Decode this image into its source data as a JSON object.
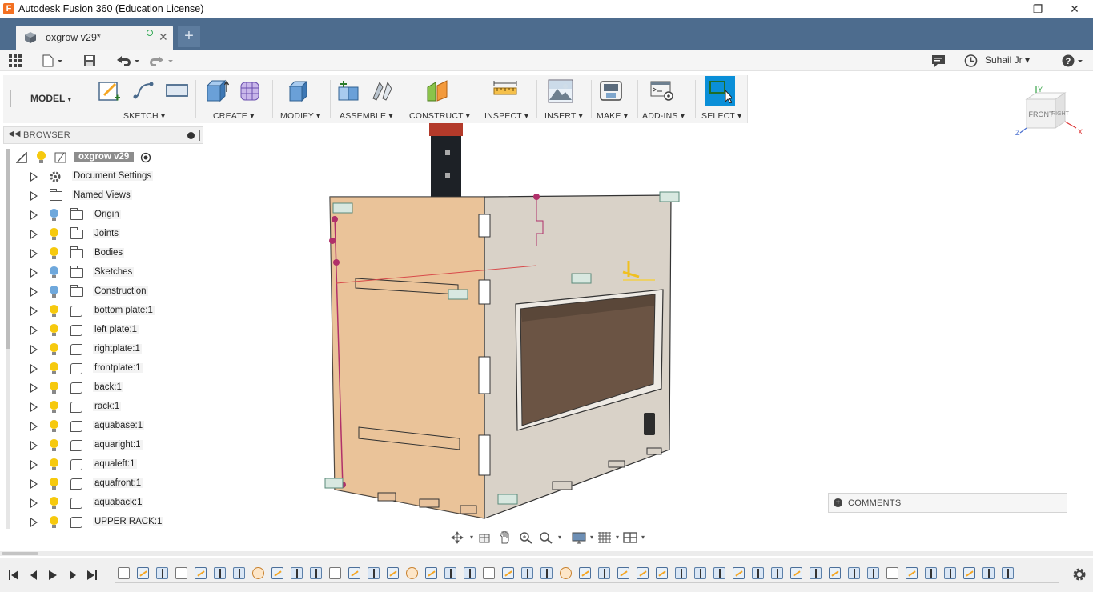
{
  "window": {
    "title": "Autodesk Fusion 360 (Education License)",
    "app_icon": "F",
    "minimize": "—",
    "maximize": "❐",
    "close": "✕"
  },
  "tab": {
    "name": "oxgrow v29*",
    "close": "✕",
    "new": "+"
  },
  "quickbar": {
    "user": "Suhail Jr",
    "user_caret": "▾",
    "help": "?"
  },
  "ribbon": {
    "workspace": "MODEL",
    "groups": [
      {
        "label": "SKETCH"
      },
      {
        "label": "CREATE"
      },
      {
        "label": "MODIFY"
      },
      {
        "label": "ASSEMBLE"
      },
      {
        "label": "CONSTRUCT"
      },
      {
        "label": "INSPECT"
      },
      {
        "label": "INSERT"
      },
      {
        "label": "MAKE"
      },
      {
        "label": "ADD-INS"
      },
      {
        "label": "SELECT"
      }
    ],
    "caret": "▾",
    "accent": "#0a8fd8"
  },
  "browser": {
    "title": "BROWSER",
    "root": "oxgrow v29",
    "items": [
      {
        "label": "Document Settings",
        "icon": "gear-icon"
      },
      {
        "label": "Named Views",
        "icon": "folder-icon"
      },
      {
        "label": "Origin",
        "icon": "folder-icon",
        "bulb": "blue"
      },
      {
        "label": "Joints",
        "icon": "folder-icon",
        "bulb": "yellow"
      },
      {
        "label": "Bodies",
        "icon": "folder-icon",
        "bulb": "yellow"
      },
      {
        "label": "Sketches",
        "icon": "folder-icon",
        "bulb": "blue"
      },
      {
        "label": "Construction",
        "icon": "folder-icon",
        "bulb": "blue"
      },
      {
        "label": "bottom plate:1",
        "icon": "component-icon",
        "bulb": "yellow"
      },
      {
        "label": "left plate:1",
        "icon": "component-icon",
        "bulb": "yellow"
      },
      {
        "label": "rightplate:1",
        "icon": "component-icon",
        "bulb": "yellow"
      },
      {
        "label": "frontplate:1",
        "icon": "component-icon",
        "bulb": "yellow"
      },
      {
        "label": "back:1",
        "icon": "component-icon",
        "bulb": "yellow"
      },
      {
        "label": "rack:1",
        "icon": "component-icon",
        "bulb": "yellow"
      },
      {
        "label": "aquabase:1",
        "icon": "component-icon",
        "bulb": "yellow"
      },
      {
        "label": "aquaright:1",
        "icon": "component-icon",
        "bulb": "yellow"
      },
      {
        "label": "aqualeft:1",
        "icon": "component-icon",
        "bulb": "yellow"
      },
      {
        "label": "aquafront:1",
        "icon": "component-icon",
        "bulb": "yellow"
      },
      {
        "label": "aquaback:1",
        "icon": "component-icon",
        "bulb": "yellow"
      },
      {
        "label": "UPPER RACK:1",
        "icon": "component-icon",
        "bulb": "yellow"
      }
    ]
  },
  "viewcube": {
    "front": "FRONT",
    "right": "RIGHT",
    "x": "X",
    "y": "Y",
    "z": "Z"
  },
  "comments": {
    "label": "COMMENTS"
  },
  "colors": {
    "tabstrip": "#4d6c8e",
    "bulb_yellow": "#f6c90e",
    "bulb_blue": "#6fa8dc"
  }
}
